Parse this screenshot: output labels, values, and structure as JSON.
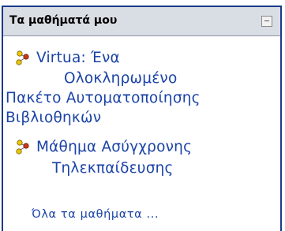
{
  "block": {
    "title": "Τα μαθήματά μου",
    "collapse_icon": "minus-box-icon",
    "courses": [
      {
        "lines": [
          "Virtua: Ένα",
          "Ολοκληρωμένο",
          "Πακέτο Αυτοματοποίησης",
          "Βιβλιοθηκών"
        ],
        "icon": "course-people-icon"
      },
      {
        "lines": [
          "Μάθημα Ασύγχρονης",
          "Τηλεκπαίδευσης"
        ],
        "icon": "course-people-icon"
      }
    ],
    "all_courses_label": "Όλα τα μαθήματα ..."
  },
  "colors": {
    "header_bg": "#d9dde4",
    "border": "#1a3a8a",
    "link": "#1a43a6",
    "icon_yellow": "#e8c800",
    "icon_red": "#c83a1a"
  }
}
